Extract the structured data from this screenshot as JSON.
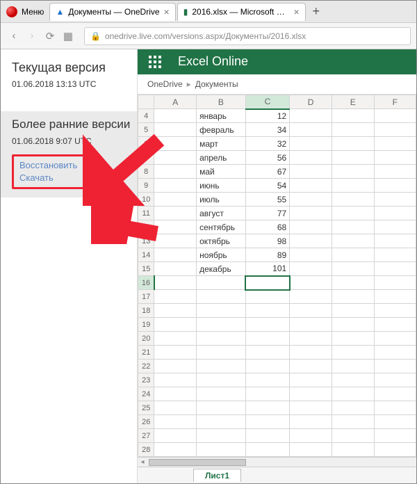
{
  "browser": {
    "menu_label": "Меню",
    "tabs": [
      {
        "title": "Документы — OneDrive",
        "favicon_color": "#1c74c9"
      },
      {
        "title": "2016.xlsx — Microsoft Exc...",
        "favicon_color": "#1f7245"
      }
    ],
    "address": "onedrive.live.com/versions.aspx/Документы/2016.xlsx"
  },
  "sidebar": {
    "current_title": "Текущая версия",
    "current_ts": "01.06.2018 13:13 UTC",
    "earlier_title": "Более ранние версии",
    "earlier_ts": "01.06.2018 9:07 UTC",
    "restore_label": "Восстановить",
    "download_label": "Скачать"
  },
  "app": {
    "title": "Excel Online",
    "breadcrumb": [
      "OneDrive",
      "Документы"
    ]
  },
  "chart_data": {
    "type": "table",
    "columns": [
      "A",
      "B",
      "C",
      "D",
      "E",
      "F"
    ],
    "selected_column": "C",
    "selected_row": 16,
    "rows": [
      {
        "n": 4,
        "B": "январь",
        "C": 12
      },
      {
        "n": 5,
        "B": "февраль",
        "C": 34
      },
      {
        "n": 6,
        "B": "март",
        "C": 32
      },
      {
        "n": 7,
        "B": "апрель",
        "C": 56
      },
      {
        "n": 8,
        "B": "май",
        "C": 67
      },
      {
        "n": 9,
        "B": "июнь",
        "C": 54
      },
      {
        "n": 10,
        "B": "июль",
        "C": 55
      },
      {
        "n": 11,
        "B": "август",
        "C": 77
      },
      {
        "n": 12,
        "B": "сентябрь",
        "C": 68
      },
      {
        "n": 13,
        "B": "октябрь",
        "C": 98
      },
      {
        "n": 14,
        "B": "ноябрь",
        "C": 89
      },
      {
        "n": 15,
        "B": "декабрь",
        "C": 101
      },
      {
        "n": 16
      },
      {
        "n": 17
      },
      {
        "n": 18
      },
      {
        "n": 19
      },
      {
        "n": 20
      },
      {
        "n": 21
      },
      {
        "n": 22
      },
      {
        "n": 23
      },
      {
        "n": 24
      },
      {
        "n": 25
      },
      {
        "n": 26
      },
      {
        "n": 27
      },
      {
        "n": 28
      }
    ]
  },
  "sheet_tab": "Лист1"
}
